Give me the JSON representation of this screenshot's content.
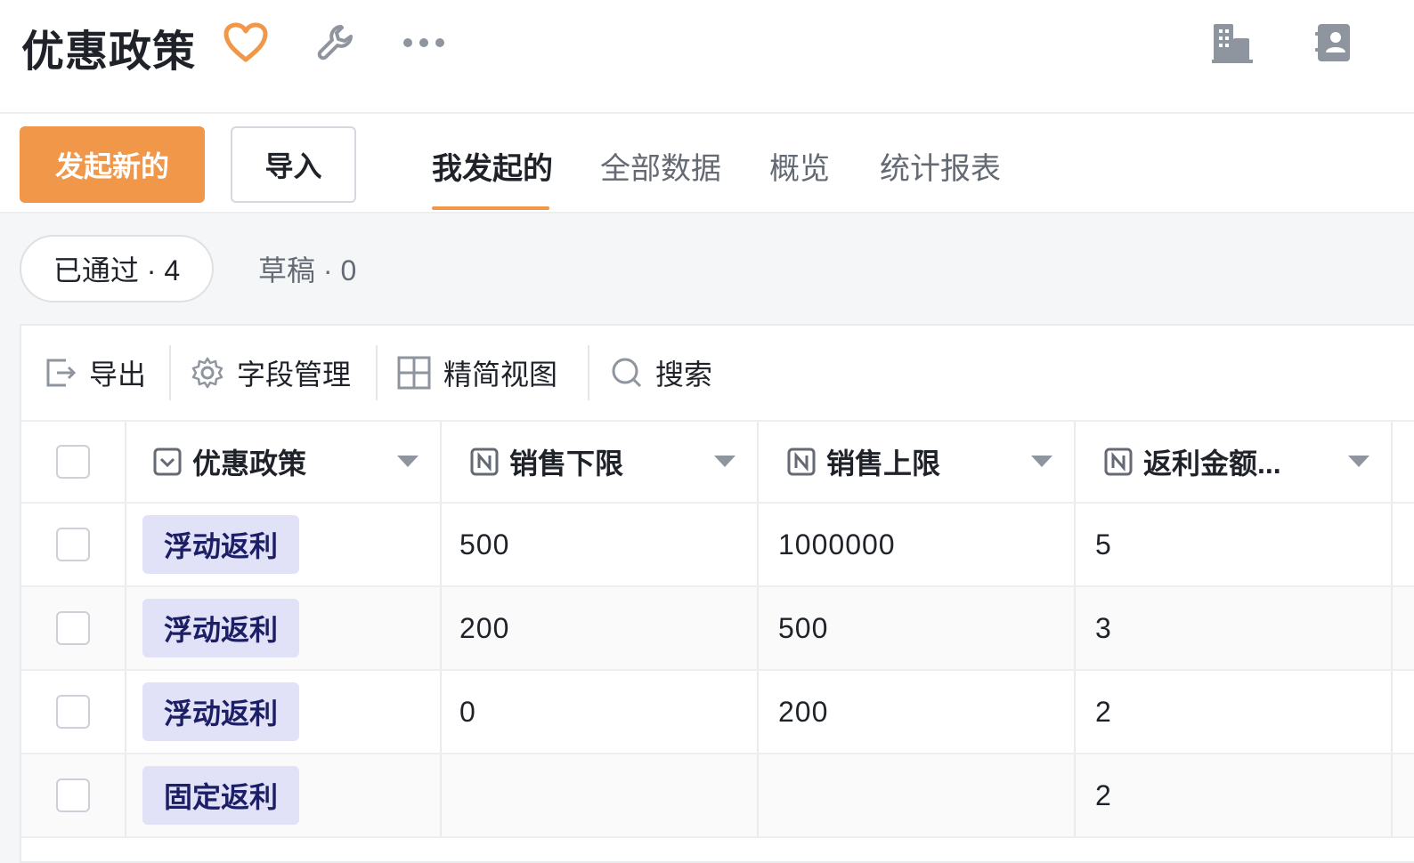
{
  "header": {
    "title": "优惠政策",
    "icons": [
      "heart-icon",
      "wrench-icon",
      "more-icon",
      "building-icon",
      "contact-card-icon"
    ],
    "accent_color": "#f0974a"
  },
  "actions": {
    "primary_button": "发起新的",
    "import_button": "导入"
  },
  "tabs": [
    {
      "label": "我发起的",
      "active": true
    },
    {
      "label": "全部数据",
      "active": false
    },
    {
      "label": "概览",
      "active": false
    },
    {
      "label": "统计报表",
      "active": false
    }
  ],
  "filters": {
    "approved": "已通过 · 4",
    "draft": "草稿 · 0"
  },
  "toolbar": {
    "export": "导出",
    "field_manage": "字段管理",
    "compact_view": "精简视图",
    "search": "搜索"
  },
  "table": {
    "columns": [
      "优惠政策",
      "销售下限",
      "销售上限",
      "返利金额..."
    ],
    "rows": [
      {
        "policy": "浮动返利",
        "lower": "500",
        "upper": "1000000",
        "rebate": "5"
      },
      {
        "policy": "浮动返利",
        "lower": "200",
        "upper": "500",
        "rebate": "3"
      },
      {
        "policy": "浮动返利",
        "lower": "0",
        "upper": "200",
        "rebate": "2"
      },
      {
        "policy": "固定返利",
        "lower": "",
        "upper": "",
        "rebate": "2"
      }
    ]
  }
}
